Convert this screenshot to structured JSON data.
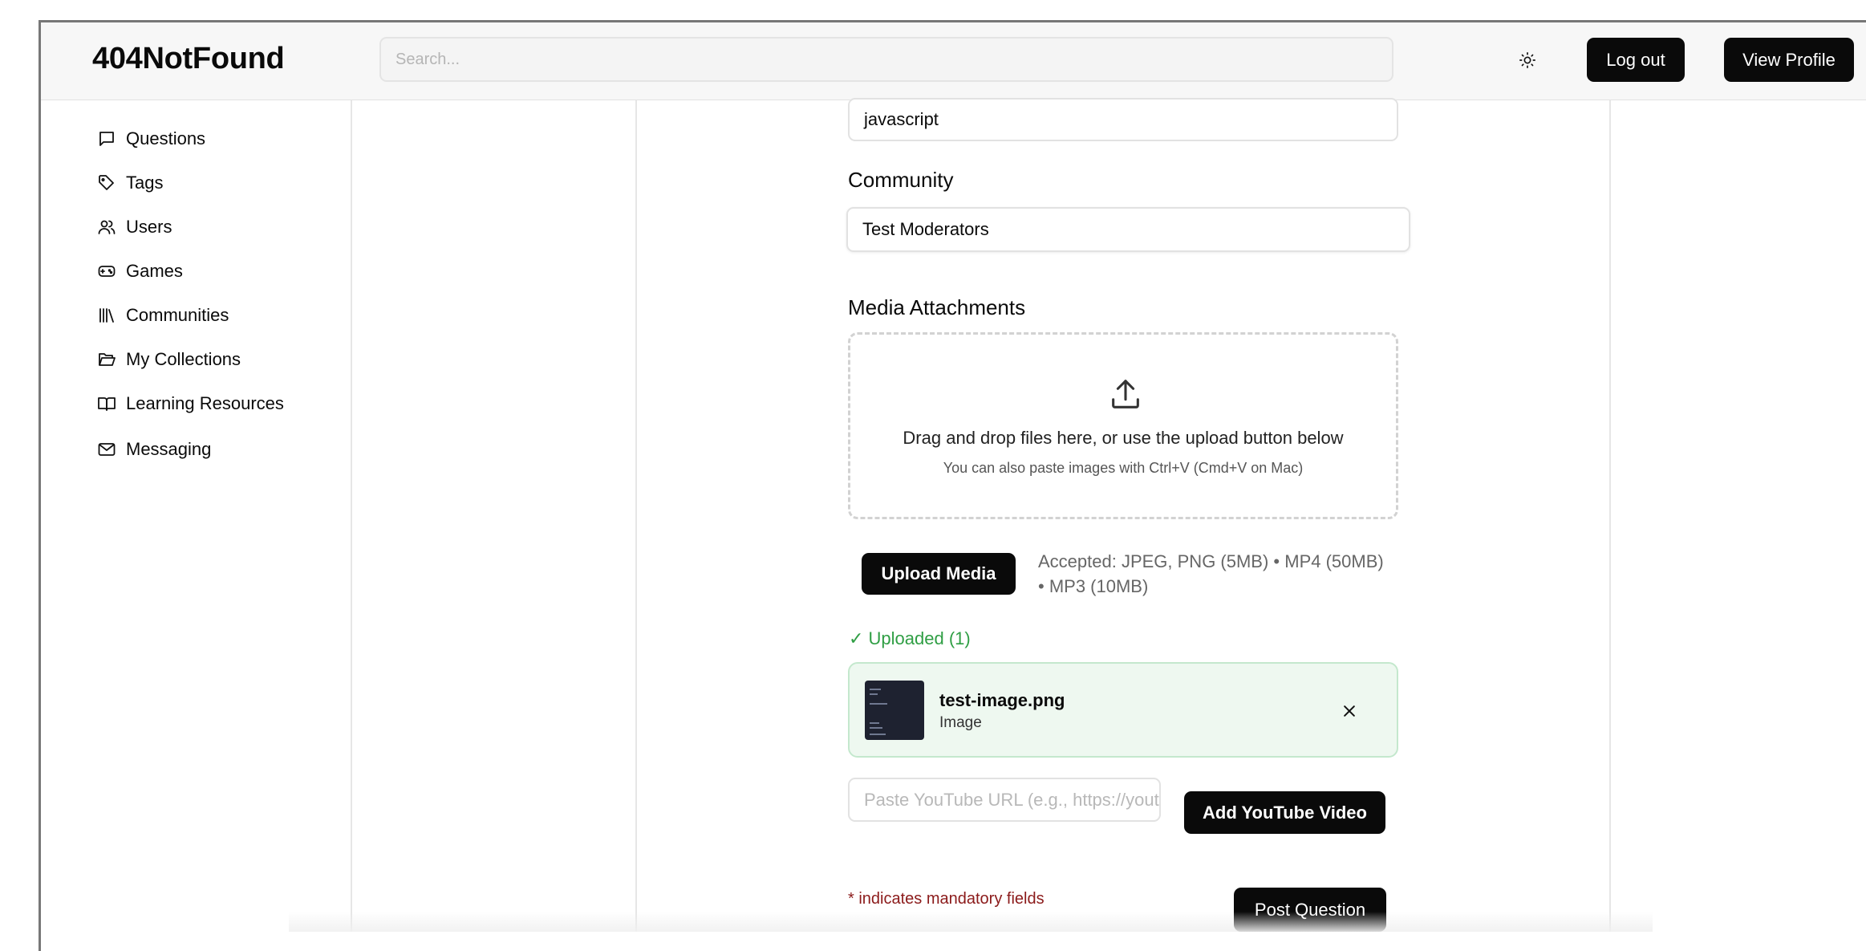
{
  "app": {
    "logo": "404NotFound"
  },
  "header": {
    "search_placeholder": "Search...",
    "theme_icon": "sun-icon",
    "logout_label": "Log out",
    "view_profile_label": "View Profile"
  },
  "sidebar": {
    "items": [
      {
        "label": "Questions",
        "icon": "message-square-icon"
      },
      {
        "label": "Tags",
        "icon": "tag-icon"
      },
      {
        "label": "Users",
        "icon": "users-icon"
      },
      {
        "label": "Games",
        "icon": "gamepad-icon"
      },
      {
        "label": "Communities",
        "icon": "library-icon"
      },
      {
        "label": "My Collections",
        "icon": "folder-open-icon"
      },
      {
        "label": "Learning Resources",
        "icon": "book-open-icon"
      },
      {
        "label": "Messaging",
        "icon": "mail-icon"
      }
    ]
  },
  "form": {
    "tags_value": "javascript",
    "community_label": "Community",
    "community_value": "Test Moderators",
    "media_label": "Media Attachments",
    "dropzone_main": "Drag and drop files here, or use the upload button below",
    "dropzone_sub": "You can also paste images with Ctrl+V (Cmd+V on Mac)",
    "upload_button": "Upload Media",
    "accepted_line1": "Accepted: JPEG, PNG (5MB) • MP4 (50MB)",
    "accepted_line2": "• MP3 (10MB)",
    "uploaded_title": "✓ Uploaded (1)",
    "file": {
      "name": "test-image.png",
      "type": "Image"
    },
    "youtube_placeholder": "Paste YouTube URL (e.g., https://youtube.com/...)",
    "youtube_button": "Add YouTube Video",
    "mandatory_note": "* indicates mandatory fields",
    "post_button": "Post Question"
  },
  "colors": {
    "accent": "#0a0a0a",
    "success": "#2f9e44",
    "success_bg": "#eef8f0",
    "error": "#8b1a1a"
  }
}
